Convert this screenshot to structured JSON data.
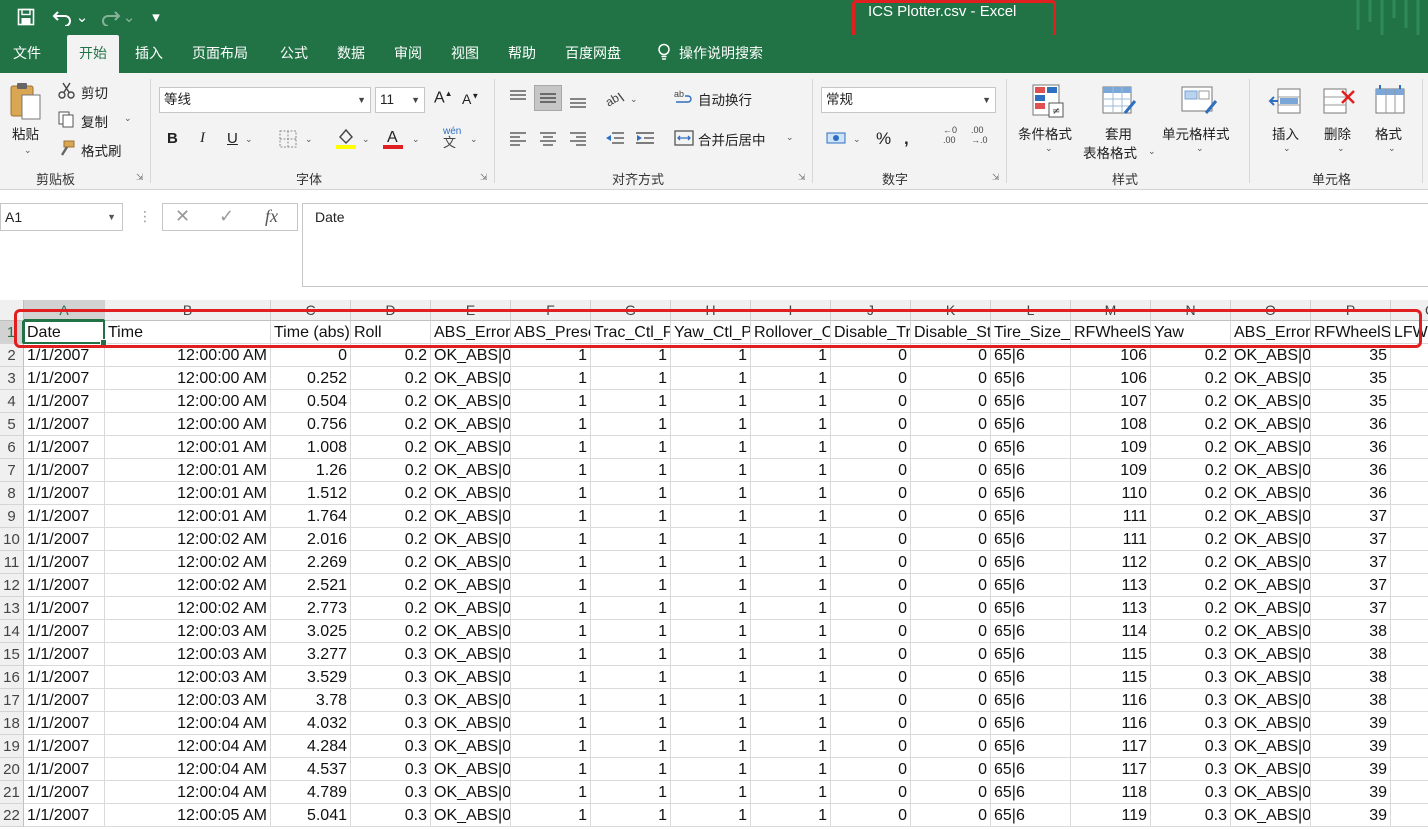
{
  "title": {
    "text": "ICS Plotter.csv  -  Excel",
    "qa": {
      "save": "save-icon",
      "undo": "undo-icon",
      "redo": "redo-icon",
      "customize": "customize-icon"
    }
  },
  "tabs": [
    "文件",
    "开始",
    "插入",
    "页面布局",
    "公式",
    "数据",
    "审阅",
    "视图",
    "帮助",
    "百度网盘",
    "操作说明搜索"
  ],
  "ribbon": {
    "clipboard": {
      "paste": "粘贴",
      "cut": "剪切",
      "copy": "复制",
      "painter": "格式刷",
      "label": "剪贴板"
    },
    "font": {
      "name": "等线",
      "size": "11",
      "bold": "B",
      "italic": "I",
      "underline": "U",
      "phonetic": "wén",
      "label": "字体"
    },
    "alignment": {
      "wrap": "自动换行",
      "merge": "合并后居中",
      "label": "对齐方式"
    },
    "number": {
      "format": "常规",
      "label": "数字"
    },
    "styles": {
      "conditional": "条件格式",
      "table_line1": "套用",
      "table_line2": "表格格式",
      "cell_styles": "单元格样式",
      "label": "样式"
    },
    "cells": {
      "insert": "插入",
      "delete": "删除",
      "format": "格式",
      "label": "单元格"
    },
    "colors": {
      "accent": "#217346",
      "highlight": "#ffff00",
      "font_color": "#e02020"
    }
  },
  "formula_bar": {
    "name_box": "A1",
    "content": "Date"
  },
  "sheet": {
    "columns": [
      "A",
      "B",
      "C",
      "D",
      "E",
      "F",
      "G",
      "H",
      "I",
      "J",
      "K",
      "L",
      "M",
      "N",
      "O",
      "P",
      "Q"
    ],
    "header_row": [
      "Date",
      "Time",
      "Time (abs)",
      "Roll",
      "ABS_Error_",
      "ABS_Prese",
      "Trac_Ctl_P",
      "Yaw_Ctl_P",
      "Rollover_C",
      "Disable_Tr",
      "Disable_St",
      "Tire_Size_S",
      "RFWheelS",
      "Yaw",
      "ABS_Error_",
      "RFWheelS",
      "LFW"
    ],
    "rows": [
      [
        "1/1/2007",
        "12:00:00 AM",
        "0",
        "0.2",
        "OK_ABS|0",
        "1",
        "1",
        "1",
        "1",
        "0",
        "0",
        "65|6",
        "106",
        "0.2",
        "OK_ABS|0",
        "35"
      ],
      [
        "1/1/2007",
        "12:00:00 AM",
        "0.252",
        "0.2",
        "OK_ABS|0",
        "1",
        "1",
        "1",
        "1",
        "0",
        "0",
        "65|6",
        "106",
        "0.2",
        "OK_ABS|0",
        "35"
      ],
      [
        "1/1/2007",
        "12:00:00 AM",
        "0.504",
        "0.2",
        "OK_ABS|0",
        "1",
        "1",
        "1",
        "1",
        "0",
        "0",
        "65|6",
        "107",
        "0.2",
        "OK_ABS|0",
        "35"
      ],
      [
        "1/1/2007",
        "12:00:00 AM",
        "0.756",
        "0.2",
        "OK_ABS|0",
        "1",
        "1",
        "1",
        "1",
        "0",
        "0",
        "65|6",
        "108",
        "0.2",
        "OK_ABS|0",
        "36"
      ],
      [
        "1/1/2007",
        "12:00:01 AM",
        "1.008",
        "0.2",
        "OK_ABS|0",
        "1",
        "1",
        "1",
        "1",
        "0",
        "0",
        "65|6",
        "109",
        "0.2",
        "OK_ABS|0",
        "36"
      ],
      [
        "1/1/2007",
        "12:00:01 AM",
        "1.26",
        "0.2",
        "OK_ABS|0",
        "1",
        "1",
        "1",
        "1",
        "0",
        "0",
        "65|6",
        "109",
        "0.2",
        "OK_ABS|0",
        "36"
      ],
      [
        "1/1/2007",
        "12:00:01 AM",
        "1.512",
        "0.2",
        "OK_ABS|0",
        "1",
        "1",
        "1",
        "1",
        "0",
        "0",
        "65|6",
        "110",
        "0.2",
        "OK_ABS|0",
        "36"
      ],
      [
        "1/1/2007",
        "12:00:01 AM",
        "1.764",
        "0.2",
        "OK_ABS|0",
        "1",
        "1",
        "1",
        "1",
        "0",
        "0",
        "65|6",
        "111",
        "0.2",
        "OK_ABS|0",
        "37"
      ],
      [
        "1/1/2007",
        "12:00:02 AM",
        "2.016",
        "0.2",
        "OK_ABS|0",
        "1",
        "1",
        "1",
        "1",
        "0",
        "0",
        "65|6",
        "111",
        "0.2",
        "OK_ABS|0",
        "37"
      ],
      [
        "1/1/2007",
        "12:00:02 AM",
        "2.269",
        "0.2",
        "OK_ABS|0",
        "1",
        "1",
        "1",
        "1",
        "0",
        "0",
        "65|6",
        "112",
        "0.2",
        "OK_ABS|0",
        "37"
      ],
      [
        "1/1/2007",
        "12:00:02 AM",
        "2.521",
        "0.2",
        "OK_ABS|0",
        "1",
        "1",
        "1",
        "1",
        "0",
        "0",
        "65|6",
        "113",
        "0.2",
        "OK_ABS|0",
        "37"
      ],
      [
        "1/1/2007",
        "12:00:02 AM",
        "2.773",
        "0.2",
        "OK_ABS|0",
        "1",
        "1",
        "1",
        "1",
        "0",
        "0",
        "65|6",
        "113",
        "0.2",
        "OK_ABS|0",
        "37"
      ],
      [
        "1/1/2007",
        "12:00:03 AM",
        "3.025",
        "0.2",
        "OK_ABS|0",
        "1",
        "1",
        "1",
        "1",
        "0",
        "0",
        "65|6",
        "114",
        "0.2",
        "OK_ABS|0",
        "38"
      ],
      [
        "1/1/2007",
        "12:00:03 AM",
        "3.277",
        "0.3",
        "OK_ABS|0",
        "1",
        "1",
        "1",
        "1",
        "0",
        "0",
        "65|6",
        "115",
        "0.3",
        "OK_ABS|0",
        "38"
      ],
      [
        "1/1/2007",
        "12:00:03 AM",
        "3.529",
        "0.3",
        "OK_ABS|0",
        "1",
        "1",
        "1",
        "1",
        "0",
        "0",
        "65|6",
        "115",
        "0.3",
        "OK_ABS|0",
        "38"
      ],
      [
        "1/1/2007",
        "12:00:03 AM",
        "3.78",
        "0.3",
        "OK_ABS|0",
        "1",
        "1",
        "1",
        "1",
        "0",
        "0",
        "65|6",
        "116",
        "0.3",
        "OK_ABS|0",
        "38"
      ],
      [
        "1/1/2007",
        "12:00:04 AM",
        "4.032",
        "0.3",
        "OK_ABS|0",
        "1",
        "1",
        "1",
        "1",
        "0",
        "0",
        "65|6",
        "116",
        "0.3",
        "OK_ABS|0",
        "39"
      ],
      [
        "1/1/2007",
        "12:00:04 AM",
        "4.284",
        "0.3",
        "OK_ABS|0",
        "1",
        "1",
        "1",
        "1",
        "0",
        "0",
        "65|6",
        "117",
        "0.3",
        "OK_ABS|0",
        "39"
      ],
      [
        "1/1/2007",
        "12:00:04 AM",
        "4.537",
        "0.3",
        "OK_ABS|0",
        "1",
        "1",
        "1",
        "1",
        "0",
        "0",
        "65|6",
        "117",
        "0.3",
        "OK_ABS|0",
        "39"
      ],
      [
        "1/1/2007",
        "12:00:04 AM",
        "4.789",
        "0.3",
        "OK_ABS|0",
        "1",
        "1",
        "1",
        "1",
        "0",
        "0",
        "65|6",
        "118",
        "0.3",
        "OK_ABS|0",
        "39"
      ],
      [
        "1/1/2007",
        "12:00:05 AM",
        "5.041",
        "0.3",
        "OK_ABS|0",
        "1",
        "1",
        "1",
        "1",
        "0",
        "0",
        "65|6",
        "119",
        "0.3",
        "OK_ABS|0",
        "39"
      ]
    ]
  }
}
